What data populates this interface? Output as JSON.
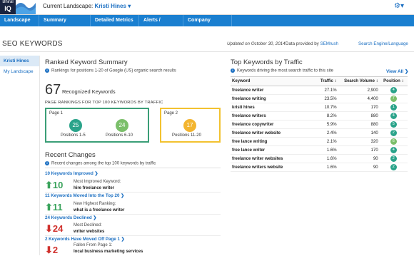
{
  "header": {
    "logo_top": "Bhiral",
    "logo_bottom": "IQ",
    "landscape_prefix": "Current Landscape:",
    "landscape_name": "Kristi Hines",
    "settings_caret": "▾"
  },
  "nav": {
    "items": [
      {
        "label": "Landscape ▾"
      },
      {
        "label": "Summary Reports ▾"
      },
      {
        "label": "Detailed Metrics ▾"
      },
      {
        "label": "Alerts / Activity ▾"
      },
      {
        "label": "Company Profiles ▾"
      }
    ]
  },
  "page": {
    "title": "SEO KEYWORDS",
    "updated": "Updated on October 30, 2014",
    "provided_prefix": "Data provided by",
    "provided_source": "SEMrush",
    "search_lang": "Search Engine/Language"
  },
  "sidebar": {
    "items": [
      {
        "label": "Kristi Hines",
        "active": true
      },
      {
        "label": "My Landscape",
        "active": false
      }
    ]
  },
  "ranked": {
    "heading": "Ranked Keyword Summary",
    "info": "Rankings for positions 1-20 of Google (US) organic search results",
    "count": "67",
    "count_label": "Recognized Keywords",
    "rankings_label": "PAGE RANKINGS FOR TOP 100 KEYWORDS BY TRAFFIC",
    "page1": {
      "label": "Page 1",
      "border_color": "#3a9e77",
      "groups": [
        {
          "value": "25",
          "label": "Positions 1-5",
          "color": "#2aa38a"
        },
        {
          "value": "24",
          "label": "Positions 6-10",
          "color": "#7bbf6a"
        }
      ]
    },
    "page2": {
      "label": "Page 2",
      "border_color": "#f2c230",
      "groups": [
        {
          "value": "17",
          "label": "Positions 11-20",
          "color": "#f3b530"
        }
      ]
    }
  },
  "recent": {
    "heading": "Recent Changes",
    "info": "Recent changes among the top 100 keywords by traffic",
    "items": [
      {
        "link": "10 Keywords Improved ❯",
        "arrow": "⬆",
        "value": "10",
        "desc": "Most Improved Keyword:",
        "keyword": "hire freelance writer",
        "dir": "up"
      },
      {
        "link": "11 Keywords Moved Into the Top 20 ❯",
        "arrow": "⬆",
        "value": "11",
        "desc": "New Highest Ranking:",
        "keyword": "what is a freelance writer",
        "dir": "up"
      },
      {
        "link": "24 Keywords Declined ❯",
        "arrow": "⬇",
        "value": "24",
        "desc": "Most Declined:",
        "keyword": "writer websites",
        "dir": "down"
      },
      {
        "link": "2 Keywords Have Moved Off Page 1 ❯",
        "arrow": "⬇",
        "value": "2",
        "desc": "Fallen From Page 1:",
        "keyword": "local business marketing services",
        "dir": "down"
      }
    ]
  },
  "top": {
    "heading": "Top Keywords by Traffic",
    "info": "Keywords driving the most search traffic to this site",
    "view_all": "View All ❯",
    "columns": [
      "Keyword",
      "Traffic ↕",
      "Search Volume ↕",
      "Position ↕"
    ],
    "rows": [
      {
        "keyword": "freelance writer",
        "traffic": "27.1%",
        "volume": "2,900",
        "position": "4",
        "color": "#2aa38a"
      },
      {
        "keyword": "freelance writing",
        "traffic": "23.5%",
        "volume": "4,400",
        "position": "7",
        "color": "#7bbf6a"
      },
      {
        "keyword": "kristi hines",
        "traffic": "10.7%",
        "volume": "170",
        "position": "1",
        "color": "#2aa38a"
      },
      {
        "keyword": "freelance writers",
        "traffic": "8.2%",
        "volume": "880",
        "position": "4",
        "color": "#2aa38a"
      },
      {
        "keyword": "freelance copywriter",
        "traffic": "5.9%",
        "volume": "880",
        "position": "5",
        "color": "#2aa38a"
      },
      {
        "keyword": "freelance writer website",
        "traffic": "2.4%",
        "volume": "140",
        "position": "2",
        "color": "#2aa38a"
      },
      {
        "keyword": "free lance writing",
        "traffic": "2.1%",
        "volume": "320",
        "position": "6",
        "color": "#7bbf6a"
      },
      {
        "keyword": "free lance writer",
        "traffic": "1.6%",
        "volume": "170",
        "position": "4",
        "color": "#2aa38a"
      },
      {
        "keyword": "freelance writer websites",
        "traffic": "1.6%",
        "volume": "90",
        "position": "2",
        "color": "#2aa38a"
      },
      {
        "keyword": "freelance writers website",
        "traffic": "1.6%",
        "volume": "90",
        "position": "2",
        "color": "#2aa38a"
      }
    ]
  }
}
